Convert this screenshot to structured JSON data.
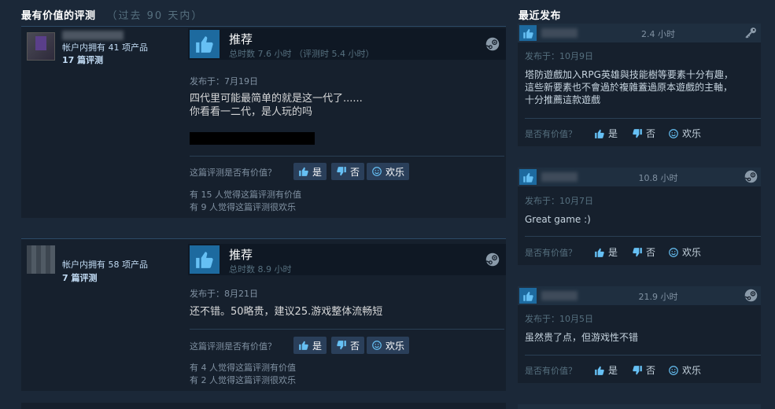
{
  "left_section": {
    "title": "最有价值的评测",
    "subtitle": "（过去 90 天内）"
  },
  "right_section": {
    "title": "最近发布"
  },
  "reviews": [
    {
      "owned": "帐户内拥有 41 项产品",
      "review_count": "17 篇评测",
      "rec_title": "推荐",
      "hours": "总时数 7.6 小时 （评测时 5.4 小时）",
      "posted": "发布于：7月19日",
      "lines": [
        "四代里可能最简单的就是这一代了......",
        "你看看一二代，是人玩的吗"
      ],
      "helpful_q": "这篇评测是否有价值？",
      "yes": "是",
      "no": "否",
      "funny": "欢乐",
      "stat1": "有 15 人觉得这篇评测有价值",
      "stat2": "有 9 人觉得这篇评测很欢乐"
    },
    {
      "owned": "帐户内拥有 58 项产品",
      "review_count": "7 篇评测",
      "rec_title": "推荐",
      "hours": "总时数 8.9 小时",
      "posted": "发布于：8月21日",
      "lines": [
        "还不错。50略贵，建议25.游戏整体流畅短"
      ],
      "helpful_q": "这篇评测是否有价值？",
      "yes": "是",
      "no": "否",
      "funny": "欢乐",
      "stat1": "有 4 人觉得这篇评测有价值",
      "stat2": "有 2 人觉得这篇评测很欢乐"
    }
  ],
  "recent": [
    {
      "hours": "2.4 小时",
      "icon": "key-icon",
      "posted": "发布于：10月9日",
      "body": [
        "塔防遊戲加入RPG英雄與技能樹等要素十分有趣，",
        "這些新要素也不會過於複雜蓋過原本遊戲的主軸，",
        "十分推薦這款遊戲"
      ],
      "helpful_q": "是否有价值？",
      "yes": "是",
      "no": "否",
      "funny": "欢乐"
    },
    {
      "hours": "10.8 小时",
      "icon": "steam-icon",
      "posted": "发布于：10月7日",
      "body": [
        "Great game :)"
      ],
      "helpful_q": "是否有价值？",
      "yes": "是",
      "no": "否",
      "funny": "欢乐"
    },
    {
      "hours": "21.9 小时",
      "icon": "steam-icon",
      "posted": "发布于：10月5日",
      "body": [
        "虽然贵了点，但游戏性不错"
      ],
      "helpful_q": "是否有价值？",
      "yes": "是",
      "no": "否",
      "funny": "欢乐"
    }
  ]
}
